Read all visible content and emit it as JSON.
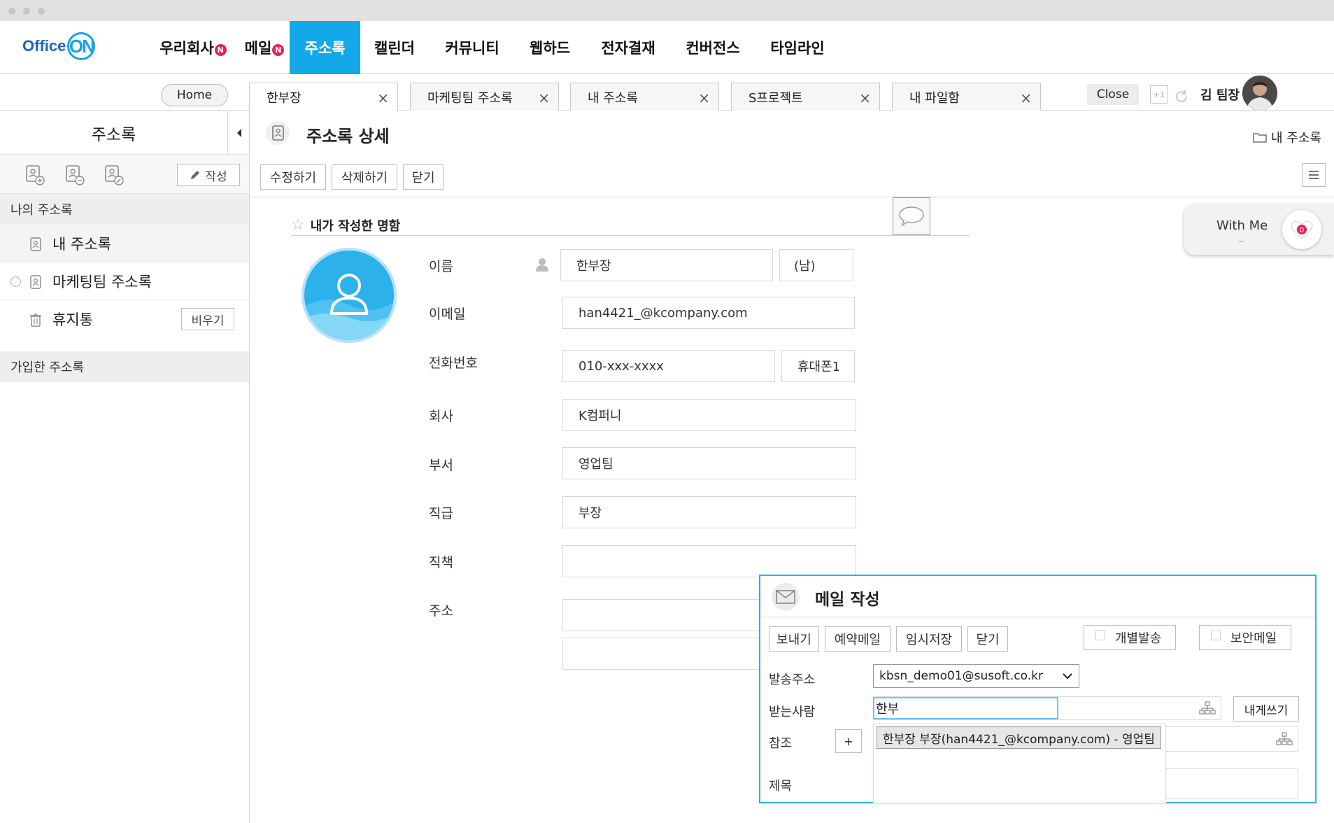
{
  "app": {
    "logo_prefix": "Office",
    "logo_suffix": "ON"
  },
  "nav": {
    "items": [
      {
        "label": "우리회사",
        "badge": "N"
      },
      {
        "label": "메일",
        "badge": "N"
      },
      {
        "label": "주소록",
        "active": true
      },
      {
        "label": "캘린더"
      },
      {
        "label": "커뮤니티"
      },
      {
        "label": "웹하드"
      },
      {
        "label": "전자결재"
      },
      {
        "label": "컨버전스"
      },
      {
        "label": "타임라인"
      }
    ]
  },
  "tabs": {
    "home_label": "Home",
    "items": [
      {
        "label": "한부장",
        "active": true
      },
      {
        "label": "마케팅팀 주소록"
      },
      {
        "label": "내 주소록"
      },
      {
        "label": "S프로젝트"
      },
      {
        "label": "내 파일함"
      }
    ],
    "close_label": "Close",
    "plus_badge": "+1",
    "user_name": "김 팀장"
  },
  "sidebar": {
    "title": "주소록",
    "write_label": "작성",
    "my_section": "나의 주소록",
    "items": [
      {
        "label": "내 주소록"
      },
      {
        "label": "마케팅팀 주소록"
      },
      {
        "label": "휴지통",
        "action": "비우기"
      }
    ],
    "joined_section": "가입한 주소록"
  },
  "main": {
    "title": "주소록 상세",
    "folder_label": "내 주소록",
    "actions": [
      "수정하기",
      "삭제하기",
      "닫기"
    ],
    "status_title": "내가 작성한 명함",
    "fields": {
      "name_label": "이름",
      "name_value": "한부장",
      "gender_value": "(남)",
      "email_label": "이메일",
      "email_value": "han4421_@kcompany.com",
      "phone_label": "전화번호",
      "phone_value": "010-xxx-xxxx",
      "phone_type": "휴대폰1",
      "company_label": "회사",
      "company_value": "K컴퍼니",
      "dept_label": "부서",
      "dept_value": "영업팀",
      "rank_label": "직급",
      "rank_value": "부장",
      "position_label": "직책",
      "position_value": "",
      "address_label": "주소",
      "address_value": ""
    }
  },
  "withme": {
    "label": "With Me",
    "count": "0"
  },
  "mail_compose": {
    "title": "메일 작성",
    "buttons": [
      "보내기",
      "예약메일",
      "임시저장",
      "닫기"
    ],
    "check_individual": "개별발송",
    "check_secure": "보안메일",
    "from_label": "발송주소",
    "from_value": "kbsn_demo01@susoft.co.kr",
    "to_label": "받는사람",
    "to_value": "한부",
    "self_write": "내게쓰기",
    "cc_label": "참조",
    "cc_plus": "+",
    "subject_label": "제목",
    "autocomplete": "한부장 부장(han4421_@kcompany.com) - 영업팀"
  }
}
